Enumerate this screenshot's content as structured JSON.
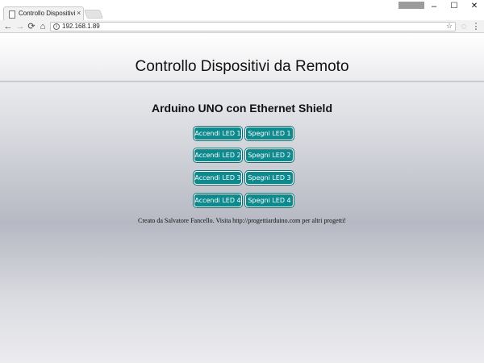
{
  "browser": {
    "tab_title": "Controllo Dispositivi da R",
    "tab_close": "×",
    "user_badge": "",
    "window_controls": {
      "minimize": "–",
      "maximize": "☐",
      "close": "✕"
    },
    "nav": {
      "back": "←",
      "forward": "→",
      "reload": "⟳",
      "home": "⌂"
    },
    "url": "192.168.1.89",
    "info_icon": "i",
    "star_icon": "☆",
    "extension_icon": "◌",
    "menu_icon": "⋮"
  },
  "page": {
    "title": "Controllo Dispositivi da Remoto",
    "subtitle": "Arduino UNO con Ethernet Shield",
    "buttons": [
      {
        "on_label": "Accendi LED 1",
        "off_label": "Spegni LED 1"
      },
      {
        "on_label": "Accendi LED 2",
        "off_label": "Spegni LED 2"
      },
      {
        "on_label": "Accendi LED 3",
        "off_label": "Spegni LED 3"
      },
      {
        "on_label": "Accendi LED 4",
        "off_label": "Spegni LED 4"
      }
    ],
    "footer": "Creato da Salvatore Fancello. Visita http://progettiarduino.com per altri progetti!"
  },
  "colors": {
    "button": "#0e8a8e",
    "button_text": "#ffffff"
  }
}
